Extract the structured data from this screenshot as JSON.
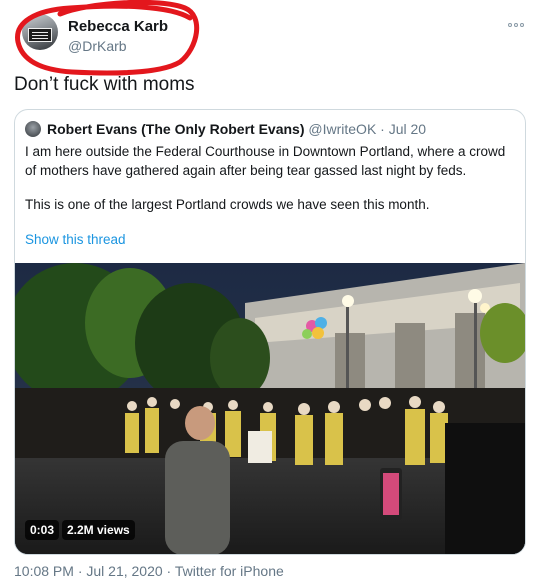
{
  "author": {
    "name": "Rebecca Karb",
    "handle": "@DrKarb",
    "avatar_icon": "profile-photo-icon"
  },
  "tweet_text": "Don’t fuck with moms",
  "more_icon": "more-options-icon",
  "quoted": {
    "name": "Robert Evans (The Only Robert Evans)",
    "handle": "@IwriteOK",
    "separator": "·",
    "date": "Jul 20",
    "paragraph1": "I am here outside the Federal Courthouse in Downtown Portland, where a crowd of mothers have gathered again after being tear gassed last night by feds.",
    "paragraph2": "This is one of the largest Portland crowds we have seen this month.",
    "show_thread": "Show this thread",
    "video": {
      "duration": "0:03",
      "views": "2.2M views"
    }
  },
  "meta": "10:08 PM · Jul 21, 2020 · Twitter for iPhone",
  "colors": {
    "text": "#14171a",
    "secondary": "#657786",
    "link": "#1b95e0",
    "border": "#cfd9de",
    "annotation": "#e3171d"
  }
}
